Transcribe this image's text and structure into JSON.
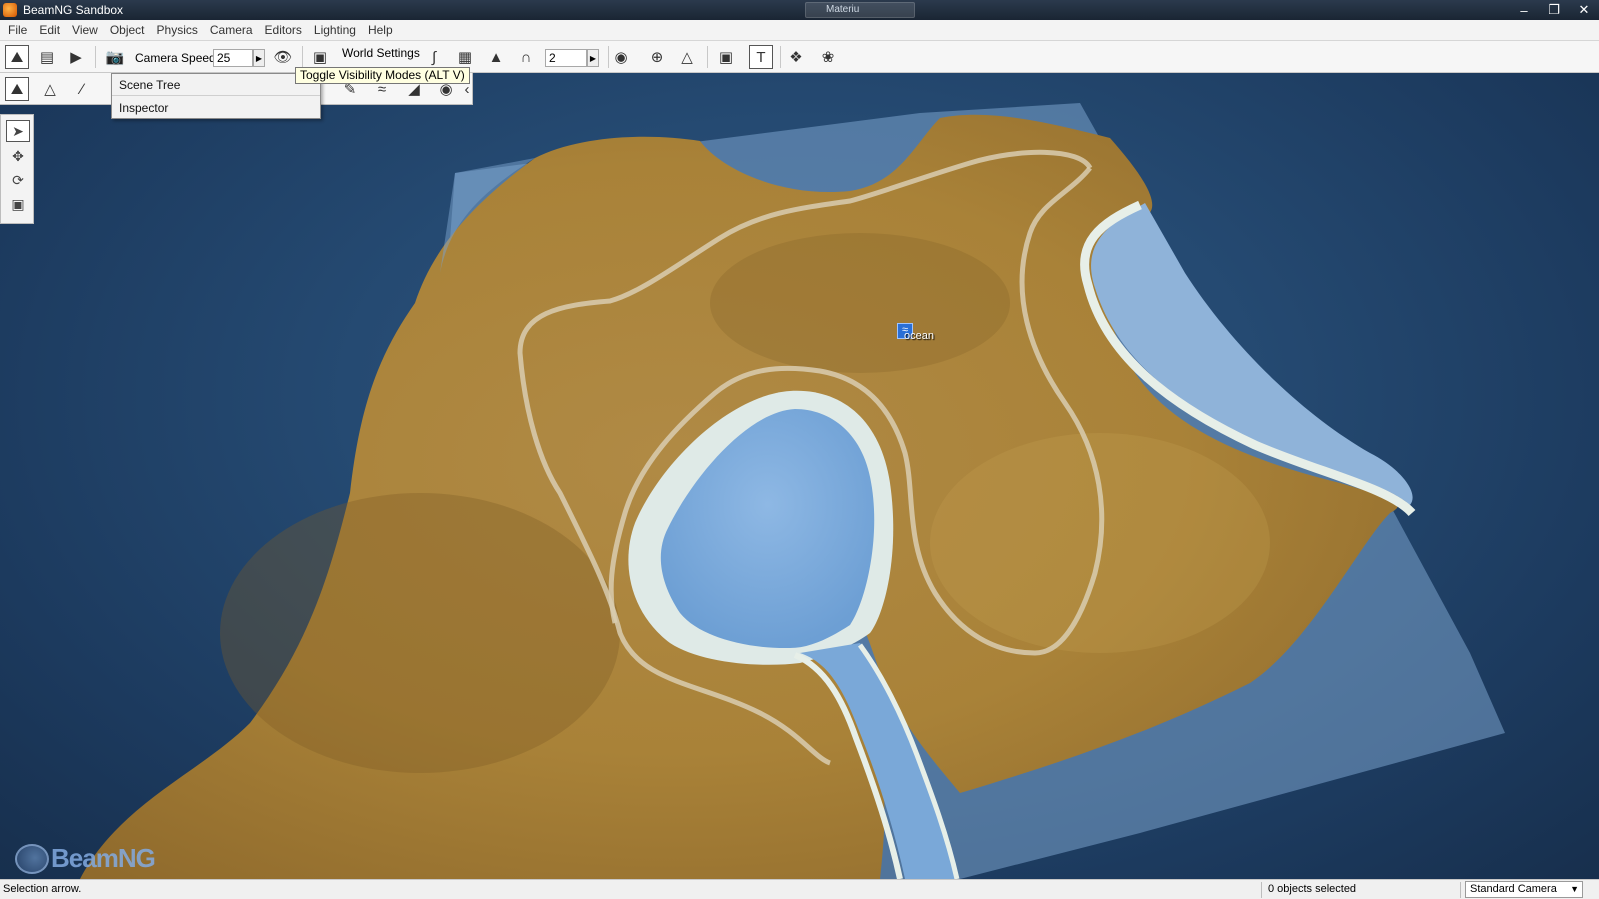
{
  "window": {
    "title": "BeamNG Sandbox",
    "search_label": "Materiu"
  },
  "menubar": {
    "items": [
      "File",
      "Edit",
      "View",
      "Object",
      "Physics",
      "Camera",
      "Editors",
      "Lighting",
      "Help"
    ]
  },
  "toolbar": {
    "camera_speed_label": "Camera Speed",
    "camera_speed_value": "25",
    "world_settings_label": "World Settings",
    "snap_value": "2"
  },
  "tooltip": {
    "text": "Toggle Visibility Modes (ALT V)"
  },
  "dropdown": {
    "items": [
      "Scene Tree",
      "Inspector"
    ]
  },
  "viewport": {
    "object_label": "ocean"
  },
  "logo": {
    "text": "BeamNG"
  },
  "statusbar": {
    "left_text": "Selection arrow.",
    "selection_text": "0 objects selected",
    "camera_mode": "Standard Camera"
  },
  "icons": {
    "toolbar": [
      "terrain-icon",
      "layout-icon",
      "play-icon",
      "camera-icon",
      "eye-icon",
      "visibility-mode-icon",
      "world-settings-icon",
      "grid-icon",
      "terrain-snap-icon",
      "magnet-icon",
      "bounds-icon",
      "axis-gizmo-icon",
      "object-snap-icon",
      "center-icon",
      "text-icon",
      "decal-icon",
      "eagle-icon"
    ],
    "toolbar2": [
      "terrain-editor-icon",
      "terrain-brush-icon",
      "road-icon",
      "paint-icon",
      "smooth-icon",
      "flatten-icon",
      "noise-icon"
    ],
    "palette": [
      "select-arrow-icon",
      "move-icon",
      "rotate-icon",
      "scale-icon"
    ]
  },
  "colors": {
    "terrain": "#b38d44",
    "water": "#7aa8d8",
    "sky": "#254a72"
  }
}
